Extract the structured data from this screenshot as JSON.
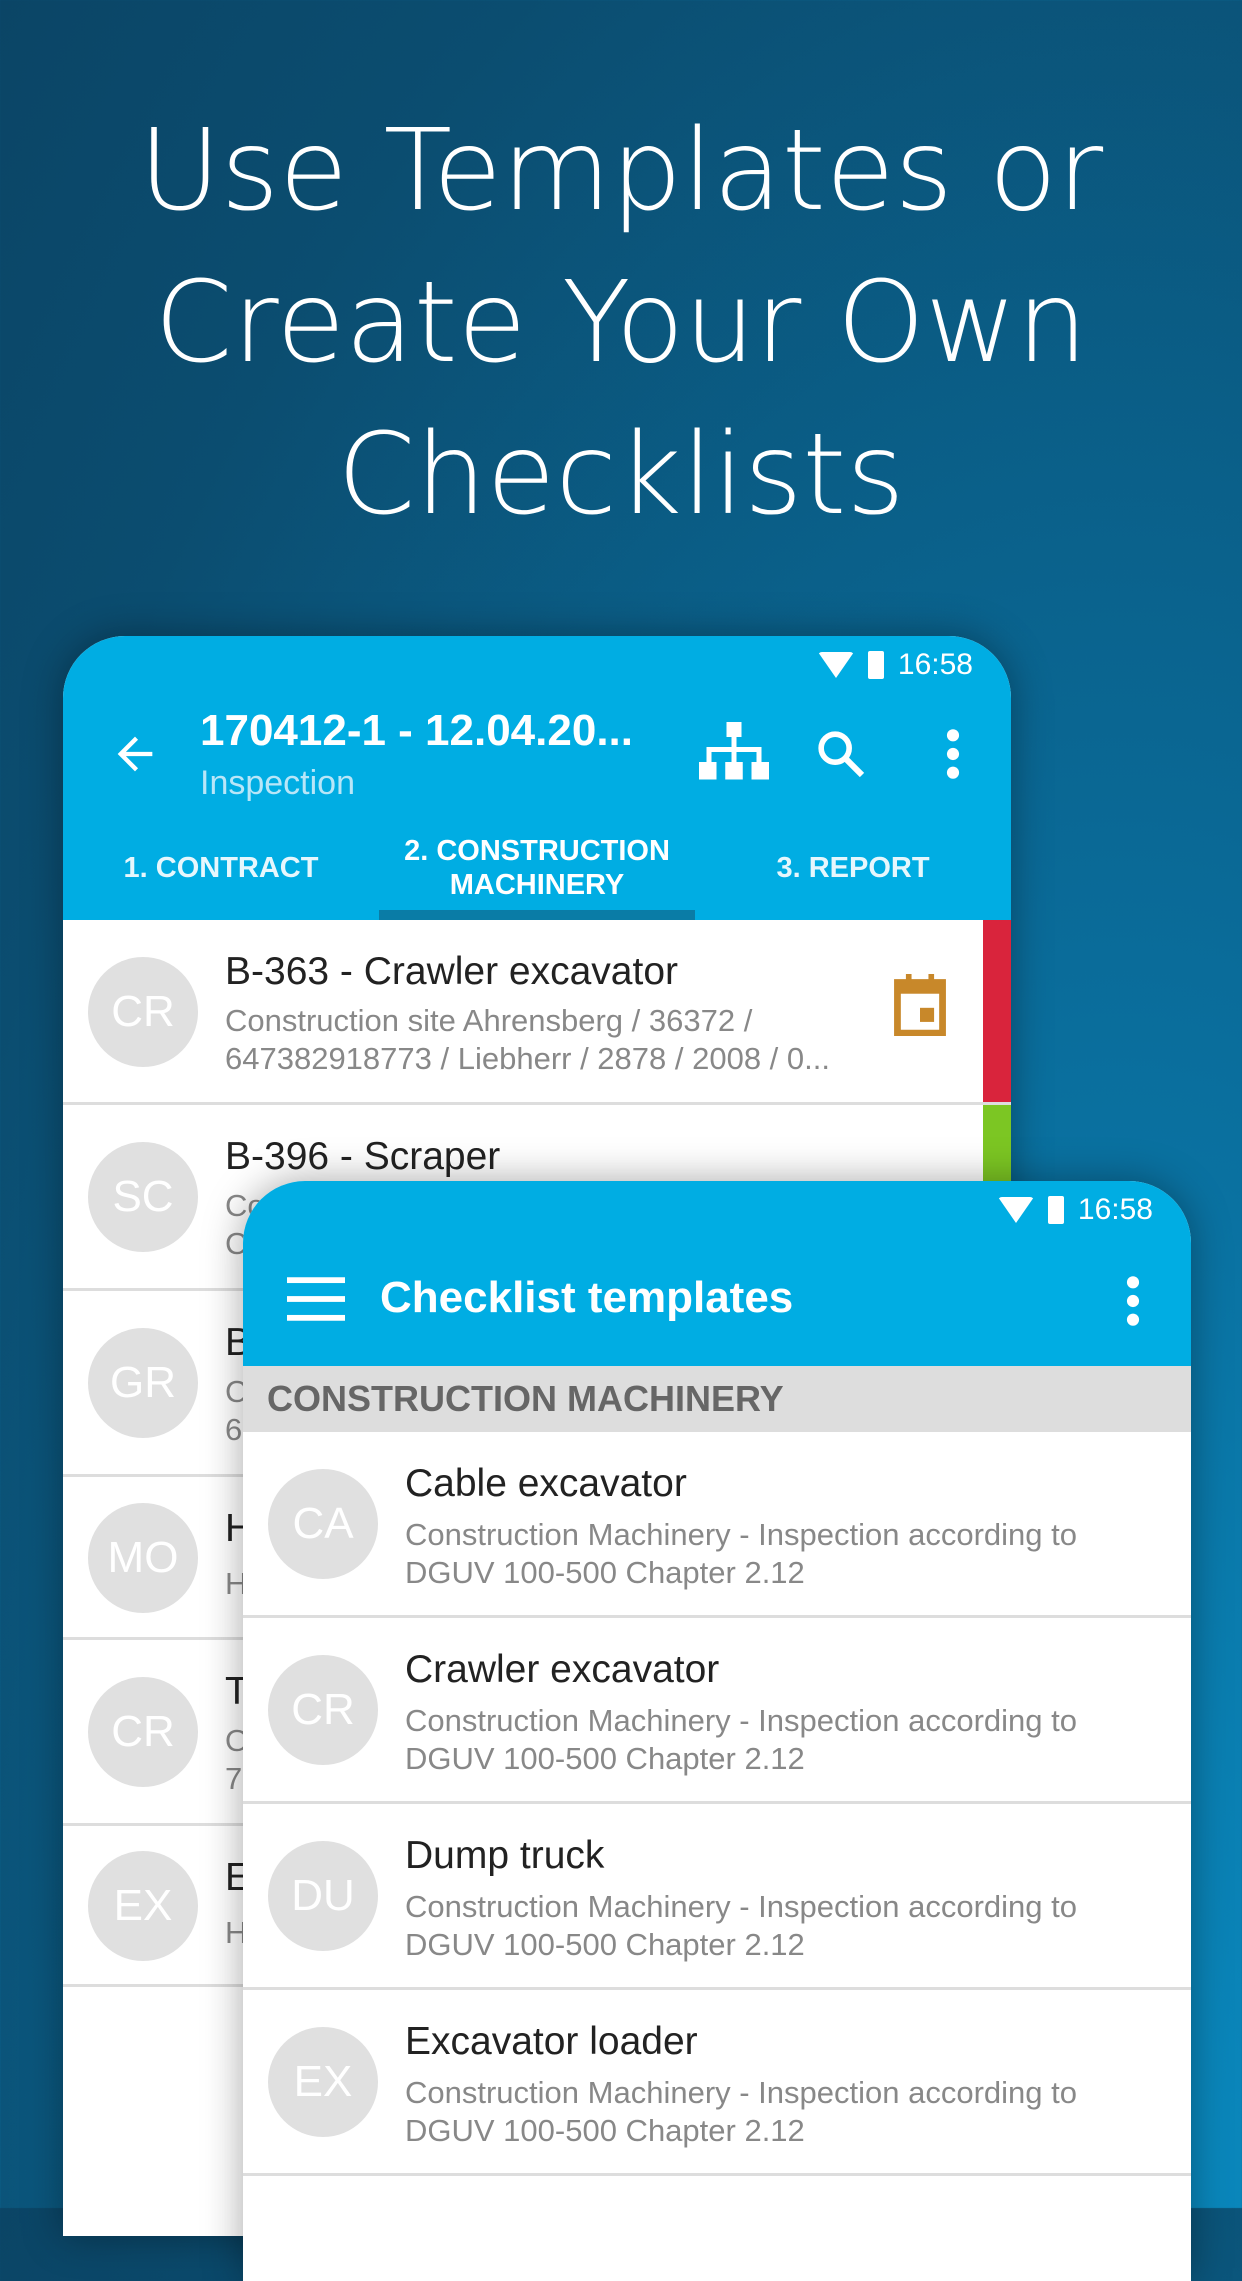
{
  "headline": [
    "Use Templates or",
    "Create Your Own",
    "Checklists"
  ],
  "back": {
    "time": "16:58",
    "title": "170412-1 - 12.04.20...",
    "subtitle": "Inspection",
    "tabs": [
      "1. CONTRACT",
      "2. CONSTRUCTION MACHINERY",
      "3. REPORT"
    ],
    "rows": [
      {
        "avatar": "CR",
        "title": "B-363 - Crawler excavator",
        "line1": "Construction site Ahrensberg / 36372 /",
        "line2": "647382918773 / Liebherr / 2878 / 2008 / 0...",
        "status_color": "#d9243c",
        "icon": "calendar-icon"
      },
      {
        "avatar": "SC",
        "title": "B-396 - Scraper",
        "line1": "Co",
        "line2": "C",
        "status_color": "#7cc623"
      },
      {
        "avatar": "GR",
        "title": "B",
        "line1": "C",
        "line2": "6"
      },
      {
        "avatar": "MO",
        "title": "H",
        "line1": "H",
        "line2": ""
      },
      {
        "avatar": "CR",
        "title": "T",
        "line1": "O",
        "line2": "7"
      },
      {
        "avatar": "EX",
        "title": "E",
        "line1": "H",
        "line2": ""
      }
    ]
  },
  "front": {
    "time": "16:58",
    "title": "Checklist templates",
    "section": "CONSTRUCTION MACHINERY",
    "rows": [
      {
        "avatar": "CA",
        "title": "Cable excavator",
        "line1": "Construction Machinery - Inspection according to",
        "line2": "DGUV 100-500 Chapter 2.12"
      },
      {
        "avatar": "CR",
        "title": "Crawler excavator",
        "line1": "Construction Machinery - Inspection according to",
        "line2": "DGUV 100-500 Chapter 2.12"
      },
      {
        "avatar": "DU",
        "title": "Dump truck",
        "line1": "Construction Machinery - Inspection according to",
        "line2": "DGUV 100-500 Chapter 2.12"
      },
      {
        "avatar": "EX",
        "title": "Excavator loader",
        "line1": "Construction Machinery - Inspection according to",
        "line2": "DGUV 100-500 Chapter 2.12"
      }
    ]
  },
  "colors": {
    "primary": "#00ade3",
    "accent": "#c8882a"
  }
}
